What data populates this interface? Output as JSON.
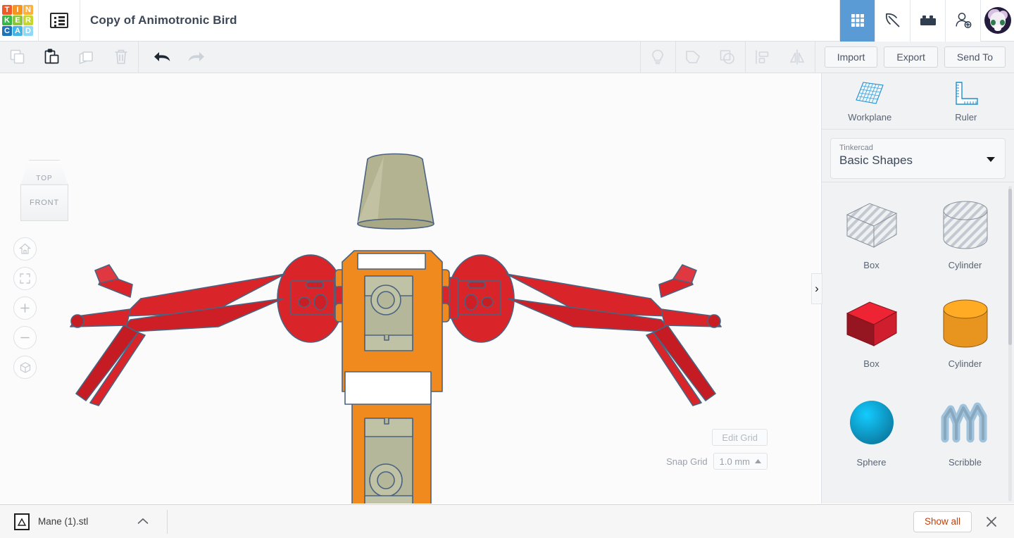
{
  "header": {
    "logo_tiles": [
      {
        "letter": "T",
        "color": "#f05a28"
      },
      {
        "letter": "I",
        "color": "#f7941e"
      },
      {
        "letter": "N",
        "color": "#fbb040"
      },
      {
        "letter": "K",
        "color": "#39b54a"
      },
      {
        "letter": "E",
        "color": "#8cc63f"
      },
      {
        "letter": "R",
        "color": "#c4d82e"
      },
      {
        "letter": "C",
        "color": "#1c75bc"
      },
      {
        "letter": "A",
        "color": "#41b6e6"
      },
      {
        "letter": "D",
        "color": "#8ed8f8"
      }
    ],
    "doc_icon": "list-panel-icon",
    "title": "Copy of Animotronic Bird",
    "right_buttons": [
      {
        "name": "grid-gallery-icon",
        "label": "Gallery",
        "active": true
      },
      {
        "name": "pickaxe-icon",
        "label": "Minecraft",
        "active": false
      },
      {
        "name": "lego-brick-icon",
        "label": "Blocks",
        "active": false
      },
      {
        "name": "add-person-icon",
        "label": "Invite",
        "active": false
      }
    ],
    "avatar_label": "User profile"
  },
  "toolbar": {
    "left_icons": [
      {
        "name": "copy-icon",
        "label": "Copy",
        "enabled": false
      },
      {
        "name": "paste-icon",
        "label": "Paste",
        "enabled": true
      },
      {
        "name": "duplicate-icon",
        "label": "Duplicate",
        "enabled": false
      },
      {
        "name": "delete-icon",
        "label": "Delete",
        "enabled": false
      }
    ],
    "history_icons": [
      {
        "name": "undo-icon",
        "label": "Undo",
        "enabled": true
      },
      {
        "name": "redo-icon",
        "label": "Redo",
        "enabled": false
      }
    ],
    "right_icons": [
      {
        "name": "lightbulb-icon",
        "label": "Hint",
        "enabled": false
      },
      {
        "name": "group-icon",
        "label": "Group",
        "enabled": false
      },
      {
        "name": "ungroup-icon",
        "label": "Ungroup",
        "enabled": false
      },
      {
        "name": "align-icon",
        "label": "Align",
        "enabled": false
      },
      {
        "name": "mirror-icon",
        "label": "Mirror",
        "enabled": false
      }
    ],
    "import_label": "Import",
    "export_label": "Export",
    "sendto_label": "Send To"
  },
  "canvas": {
    "viewcube": {
      "top_face": "TOP",
      "front_face": "FRONT"
    },
    "nav_buttons": [
      {
        "name": "home-view-button",
        "label": "Home view"
      },
      {
        "name": "fit-to-view-button",
        "label": "Fit all in view"
      },
      {
        "name": "zoom-in-button",
        "label": "Zoom in"
      },
      {
        "name": "zoom-out-button",
        "label": "Zoom out"
      },
      {
        "name": "perspective-toggle-button",
        "label": "Switch to orthographic view"
      }
    ],
    "edit_grid_label": "Edit Grid",
    "snap_grid_label": "Snap Grid",
    "snap_grid_value": "1.0 mm",
    "model_description": "Animotronic bird assembly: olive beak cone, orange body chassis, red wing discs and legs, olive servo motors",
    "model_colors": {
      "beak": "#b3b391",
      "body": "#f08a1e",
      "wings": "#d9252a",
      "servo": "#b5b79a",
      "outline": "#4a6380"
    }
  },
  "panel": {
    "workplane_label": "Workplane",
    "ruler_label": "Ruler",
    "dropdown_small": "Tinkercad",
    "dropdown_value": "Basic Shapes",
    "shapes": [
      {
        "label": "Box",
        "kind": "box",
        "color": "#c9ced4",
        "hole": true
      },
      {
        "label": "Cylinder",
        "kind": "cylinder",
        "color": "#c9ced4",
        "hole": true
      },
      {
        "label": "Box",
        "kind": "box",
        "color": "#cf1f2e",
        "hole": false
      },
      {
        "label": "Cylinder",
        "kind": "cylinder",
        "color": "#e8951f",
        "hole": false
      },
      {
        "label": "Sphere",
        "kind": "sphere",
        "color": "#0e97c8",
        "hole": false
      },
      {
        "label": "Scribble",
        "kind": "scribble",
        "color": "#9fc3dd",
        "hole": false
      }
    ],
    "collapse_label": "›"
  },
  "downloads": {
    "file_name": "Mane (1).stl",
    "file_icon": "stl-file-icon",
    "expand_label": "Show more",
    "show_all_label": "Show all",
    "close_label": "Close"
  }
}
